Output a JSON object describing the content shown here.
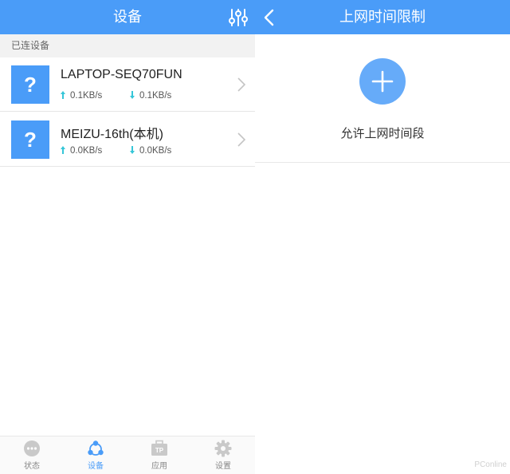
{
  "left_panel": {
    "header": {
      "title": "设备"
    },
    "section_label": "已连设备",
    "devices": [
      {
        "name": "LAPTOP-SEQ70FUN",
        "up_speed": "0.1KB/s",
        "down_speed": "0.1KB/s",
        "icon_text": "?"
      },
      {
        "name": "MEIZU-16th(本机)",
        "up_speed": "0.0KB/s",
        "down_speed": "0.0KB/s",
        "icon_text": "?"
      }
    ],
    "bottom_nav": [
      {
        "label": "状态",
        "icon": "status-dots-icon",
        "active": false
      },
      {
        "label": "设备",
        "icon": "devices-network-icon",
        "active": true
      },
      {
        "label": "应用",
        "icon": "tp-apps-icon",
        "active": false
      },
      {
        "label": "设置",
        "icon": "gear-icon",
        "active": false
      }
    ]
  },
  "right_panel": {
    "header": {
      "title": "上网时间限制"
    },
    "allow_label": "允许上网时间段"
  },
  "watermark": "PConline",
  "colors": {
    "accent": "#4a9cf8",
    "add_button": "#66abf9",
    "speed_arrow": "#35c6d8"
  }
}
